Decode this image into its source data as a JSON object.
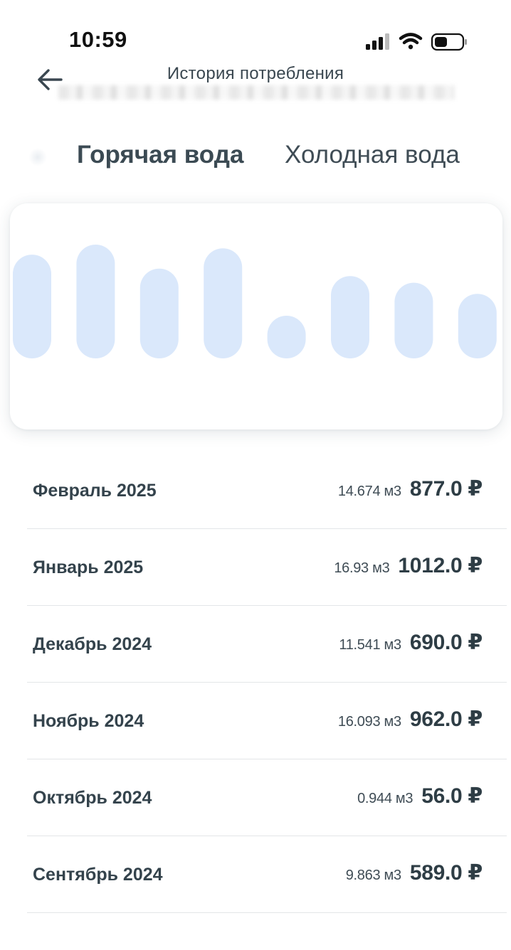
{
  "status_bar": {
    "time": "10:59",
    "icons": [
      "cellular-signal-icon",
      "wifi-icon",
      "battery-icon"
    ]
  },
  "header": {
    "title": "История потребления",
    "back_icon": "arrow-left-icon"
  },
  "tabs": [
    {
      "label": "Горячая вода",
      "active": true
    },
    {
      "label": "Холодная вода",
      "active": false
    }
  ],
  "chart_data": {
    "type": "bar",
    "values": [
      877.0,
      1012.0,
      690.0,
      962.0,
      56.0,
      589.0,
      500.0,
      350.0
    ],
    "color": "#dae8fb",
    "xlabel": "",
    "ylabel": ""
  },
  "history": [
    {
      "month": "Февраль 2025",
      "volume": "14.674 м3",
      "amount": "877.0 ₽"
    },
    {
      "month": "Январь 2025",
      "volume": "16.93 м3",
      "amount": "1012.0 ₽"
    },
    {
      "month": "Декабрь 2024",
      "volume": "11.541 м3",
      "amount": "690.0 ₽"
    },
    {
      "month": "Ноябрь 2024",
      "volume": "16.093 м3",
      "amount": "962.0 ₽"
    },
    {
      "month": "Октябрь 2024",
      "volume": "0.944 м3",
      "amount": "56.0 ₽"
    },
    {
      "month": "Сентябрь 2024",
      "volume": "9.863 м3",
      "amount": "589.0 ₽"
    }
  ],
  "colors": {
    "text_primary": "#2e3d45",
    "bar_fill": "#dae8fb",
    "divider": "#e3e6e8"
  }
}
